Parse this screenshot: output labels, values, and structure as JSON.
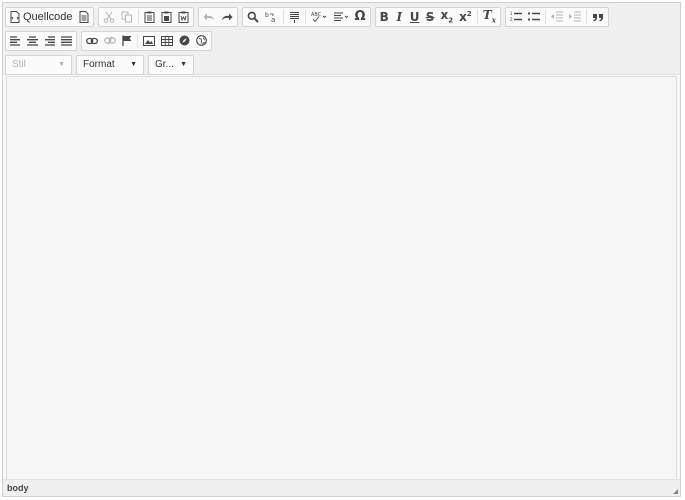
{
  "toolbar": {
    "source_label": "Quellcode",
    "styles_combo": "Stil",
    "format_combo": "Format",
    "size_combo": "Gr...",
    "special_char": "Ω"
  },
  "statusbar": {
    "path": "body"
  },
  "colors": {
    "toolbar_bg": "#f0f0f0",
    "content_bg": "#f6f6f6",
    "border": "#d1d1d1",
    "icon": "#474747",
    "icon_disabled": "#b4b4b4"
  }
}
